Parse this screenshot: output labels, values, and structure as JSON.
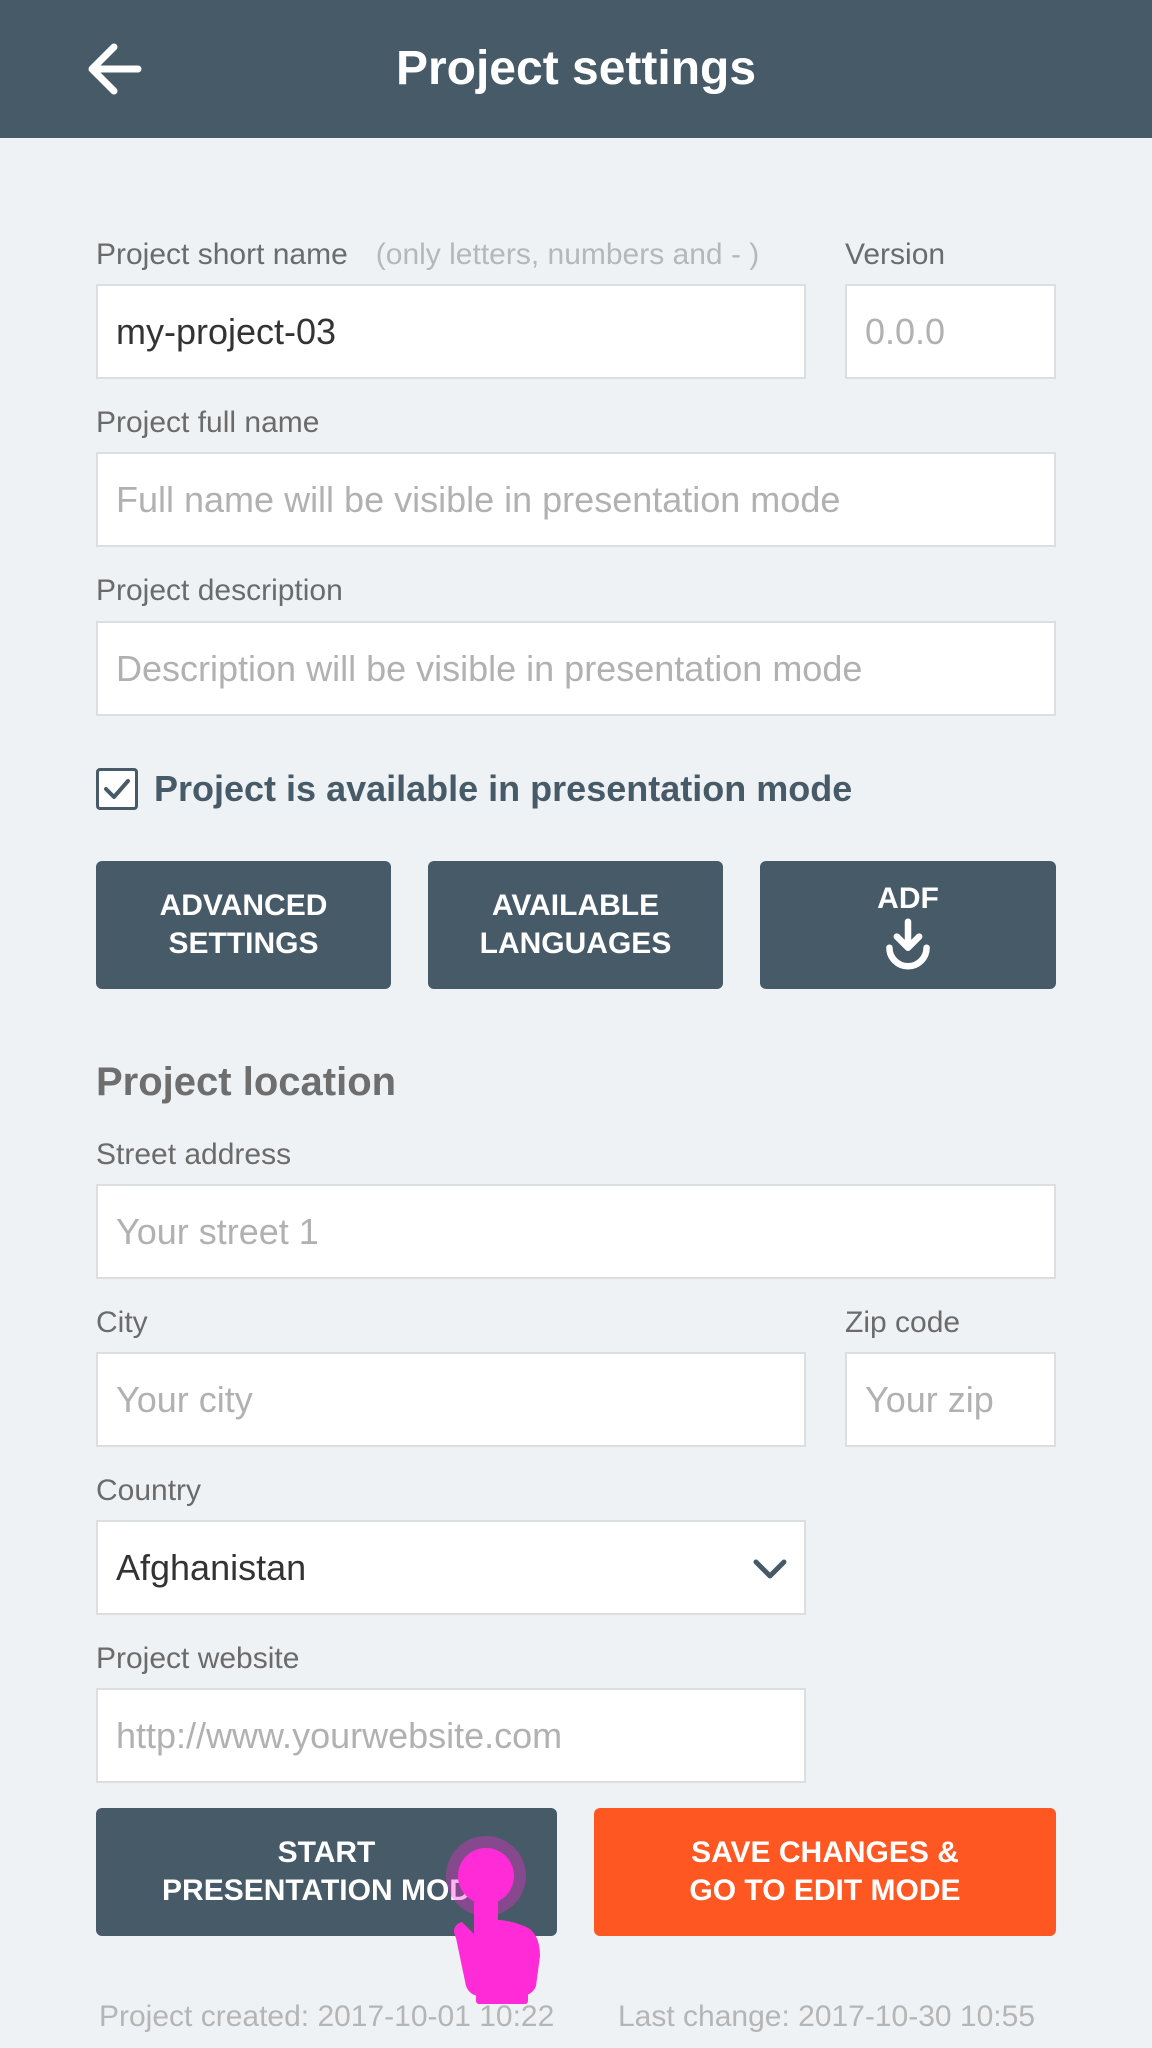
{
  "header": {
    "title": "Project settings",
    "back_icon": "arrow-left-icon"
  },
  "form": {
    "short_name": {
      "label": "Project short name",
      "hint": "(only letters, numbers and - )",
      "value": "my-project-03"
    },
    "version": {
      "label": "Version",
      "placeholder": "0.0.0"
    },
    "full_name": {
      "label": "Project full name",
      "placeholder": "Full name will be visible in presentation mode"
    },
    "description": {
      "label": "Project description",
      "placeholder": "Description will be visible in presentation mode"
    },
    "available": {
      "label": "Project is available in presentation mode",
      "checked": true
    }
  },
  "actions": {
    "advanced": [
      "ADVANCED",
      "SETTINGS"
    ],
    "languages": [
      "AVAILABLE",
      "LANGUAGES"
    ],
    "adf": {
      "label": "ADF",
      "icon": "download-icon"
    }
  },
  "location": {
    "title": "Project location",
    "street": {
      "label": "Street address",
      "placeholder": "Your street 1"
    },
    "city": {
      "label": "City",
      "placeholder": "Your city"
    },
    "zip": {
      "label": "Zip code",
      "placeholder": "Your zip"
    },
    "country": {
      "label": "Country",
      "value": "Afghanistan"
    },
    "website": {
      "label": "Project website",
      "placeholder": "http://www.yourwebsite.com"
    }
  },
  "bottom": {
    "start": [
      "START",
      "PRESENTATION MODE"
    ],
    "save": [
      "SAVE CHANGES &",
      "GO TO EDIT MODE"
    ]
  },
  "footer": {
    "created": "Project created: 2017-10-01 10:22",
    "changed": "Last change: 2017-10-30 10:55"
  },
  "colors": {
    "header": "#475a67",
    "accent": "#ff5722",
    "pointer": "#ff2bd6"
  }
}
